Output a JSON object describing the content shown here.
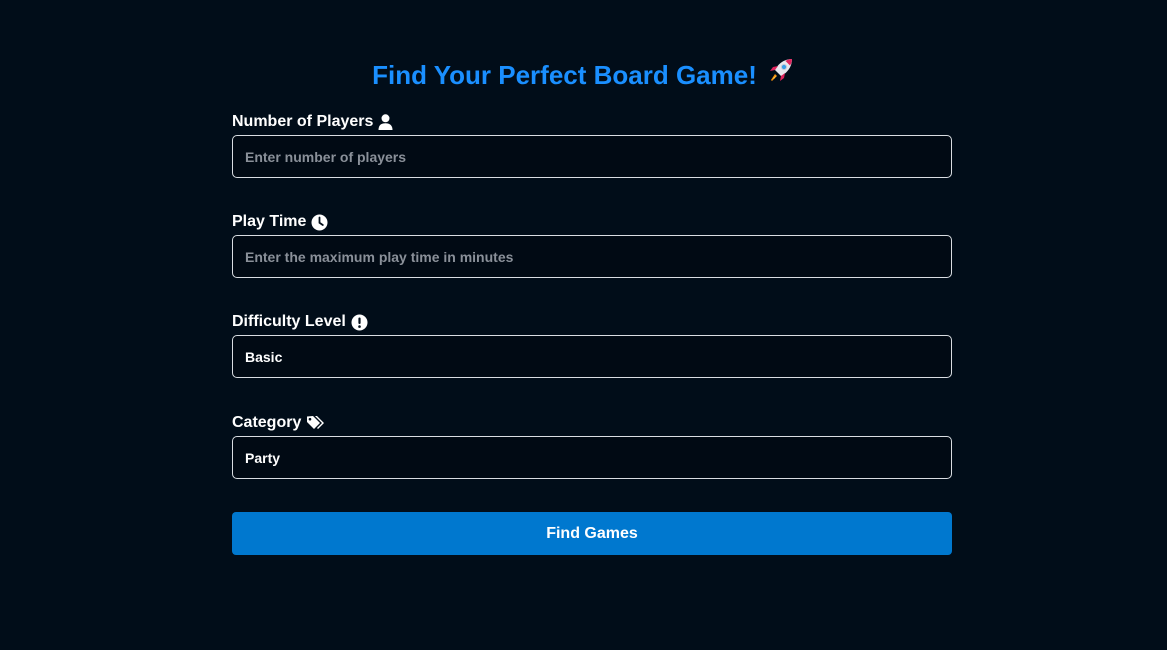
{
  "page": {
    "title": "Find Your Perfect Board Game!",
    "title_icon": "rocket-icon"
  },
  "fields": {
    "players": {
      "label": "Number of Players",
      "icon": "user-icon",
      "placeholder": "Enter number of players",
      "value": ""
    },
    "play_time": {
      "label": "Play Time",
      "icon": "clock-icon",
      "placeholder": "Enter the maximum play time in minutes",
      "value": ""
    },
    "difficulty": {
      "label": "Difficulty Level",
      "icon": "exclamation-circle-icon",
      "value": "Basic"
    },
    "category": {
      "label": "Category",
      "icon": "tags-icon",
      "value": "Party"
    }
  },
  "actions": {
    "submit_label": "Find Games"
  },
  "colors": {
    "background": "#010d19",
    "title": "#1a8fff",
    "button": "#0078cf",
    "input_border": "#d9dde2"
  }
}
